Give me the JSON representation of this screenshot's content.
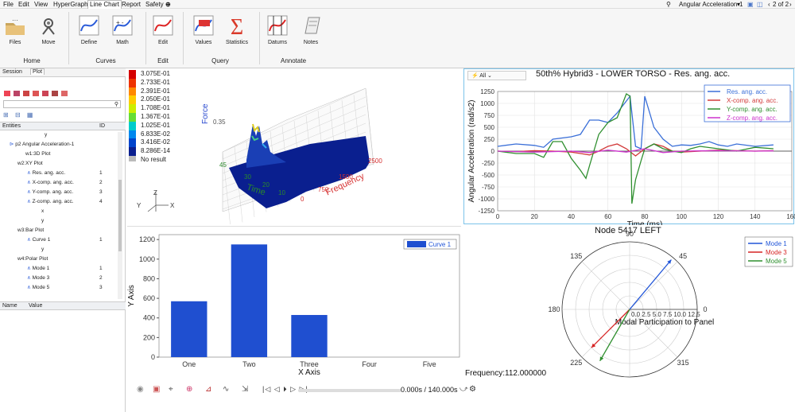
{
  "menubar": {
    "items": [
      "File",
      "Edit",
      "View",
      "HyperGraph",
      "Line Chart",
      "Report",
      "Safety"
    ],
    "page_selector": "Angular Acceleration-1",
    "page_count": "2 of 2"
  },
  "ribbon": {
    "buttons": [
      "Files",
      "Move",
      "Define",
      "Math",
      "Edit",
      "Values",
      "Statistics",
      "Datums",
      "Notes"
    ],
    "groups": [
      "Home",
      "Curves",
      "Edit",
      "Query",
      "Annotate"
    ]
  },
  "left_panel": {
    "tabs": [
      "Session",
      "Plot"
    ],
    "entities_label": "Entities",
    "tree": [
      {
        "label": "y",
        "num": ""
      },
      {
        "label": "p2 Angular Acceleration-1",
        "num": ""
      },
      {
        "label": "w1:3D Plot",
        "num": ""
      },
      {
        "label": "w2:XY Plot",
        "num": ""
      },
      {
        "label": "Res. ang. acc.",
        "num": "1"
      },
      {
        "label": "X-comp. ang. acc.",
        "num": "2"
      },
      {
        "label": "Y-comp. ang. acc.",
        "num": "3"
      },
      {
        "label": "Z-comp. ang. acc.",
        "num": "4"
      },
      {
        "label": "x",
        "num": ""
      },
      {
        "label": "y",
        "num": ""
      },
      {
        "label": "w3:Bar Plot",
        "num": ""
      },
      {
        "label": "Curve 1",
        "num": "1"
      },
      {
        "label": "y",
        "num": ""
      },
      {
        "label": "w4:Polar Plot",
        "num": ""
      },
      {
        "label": "Mode 1",
        "num": "1"
      },
      {
        "label": "Mode 3",
        "num": "2"
      },
      {
        "label": "Mode 5",
        "num": "3"
      }
    ],
    "props_name": "Name",
    "props_value": "Value"
  },
  "plot3d": {
    "legend_values": [
      "3.075E-01",
      "2.733E-01",
      "2.391E-01",
      "2.050E-01",
      "1.708E-01",
      "1.367E-01",
      "1.025E-01",
      "6.833E-02",
      "3.416E-02",
      "8.286E-14"
    ],
    "legend_colors": [
      "#d40000",
      "#ee3300",
      "#ff8800",
      "#ffcc00",
      "#ccee00",
      "#66dd33",
      "#00cccc",
      "#0088ee",
      "#0044cc",
      "#0a1f8f"
    ],
    "no_result": "No result",
    "force_label": "Force",
    "force_tick": "0.35",
    "time_label": "Time",
    "time_ticks": [
      "45",
      "30",
      "20",
      "10"
    ],
    "freq_label": "Frequency",
    "freq_ticks": [
      "2500",
      "1500",
      "750",
      "0"
    ],
    "triad": [
      "Y",
      "Z",
      "X"
    ]
  },
  "chart_data": [
    {
      "type": "line",
      "title": "50th% Hybrid3   - LOWER TORSO - Res. ang. acc.",
      "xlabel": "Time (ms)",
      "ylabel": "Angular Acceleration (rad/s2)",
      "xlim": [
        0,
        160
      ],
      "ylim": [
        -1250,
        1250
      ],
      "xticks": [
        "0",
        "20",
        "40",
        "60",
        "80",
        "100",
        "120",
        "140",
        "160"
      ],
      "yticks": [
        "1250",
        "1000",
        "750",
        "500",
        "250",
        "0",
        "-250",
        "-500",
        "-750",
        "-1000",
        "-1250"
      ],
      "filter_label": "All",
      "series": [
        {
          "name": "Res. ang. acc.",
          "color": "#3a6fd8",
          "x": [
            0,
            10,
            20,
            25,
            30,
            40,
            45,
            50,
            55,
            60,
            65,
            70,
            72,
            75,
            78,
            80,
            85,
            90,
            95,
            100,
            105,
            110,
            115,
            120,
            125,
            130,
            140,
            150
          ],
          "y": [
            100,
            150,
            120,
            80,
            250,
            300,
            350,
            650,
            650,
            600,
            800,
            1050,
            1150,
            100,
            50,
            1150,
            500,
            250,
            100,
            130,
            120,
            150,
            200,
            130,
            100,
            150,
            100,
            130
          ]
        },
        {
          "name": "X-comp. ang. acc.",
          "color": "#d23a3a",
          "x": [
            0,
            10,
            20,
            30,
            40,
            45,
            50,
            55,
            60,
            65,
            70,
            75,
            80,
            85,
            90,
            95,
            100,
            110,
            120,
            130,
            140,
            150
          ],
          "y": [
            0,
            -10,
            10,
            0,
            -20,
            -50,
            -80,
            0,
            100,
            150,
            50,
            -100,
            50,
            150,
            100,
            0,
            -20,
            0,
            20,
            10,
            0,
            10
          ]
        },
        {
          "name": "Y-comp. ang. acc.",
          "color": "#2f8f2f",
          "x": [
            0,
            10,
            20,
            25,
            30,
            35,
            40,
            45,
            48,
            50,
            55,
            60,
            65,
            70,
            72,
            73,
            75,
            78,
            80,
            85,
            90,
            95,
            100,
            105,
            110,
            120,
            130,
            140,
            150
          ],
          "y": [
            0,
            -50,
            -50,
            -130,
            200,
            200,
            -150,
            -400,
            -570,
            -300,
            350,
            600,
            700,
            1200,
            1150,
            -1100,
            -600,
            -200,
            50,
            150,
            50,
            0,
            -30,
            50,
            100,
            50,
            0,
            80,
            50
          ]
        },
        {
          "name": "Z-comp. ang. acc.",
          "color": "#cc33cc",
          "x": [
            0,
            20,
            40,
            50,
            60,
            70,
            80,
            90,
            100,
            120,
            140,
            150
          ],
          "y": [
            0,
            -20,
            0,
            -30,
            20,
            -20,
            50,
            -30,
            0,
            10,
            0,
            5
          ]
        }
      ]
    },
    {
      "type": "bar",
      "categories": [
        "One",
        "Two",
        "Three",
        "Four",
        "Five"
      ],
      "values": [
        570,
        1150,
        430,
        0,
        0
      ],
      "xlabel": "X Axis",
      "ylabel": "Y Axis",
      "ylim": [
        0,
        1250
      ],
      "yticks": [
        "0",
        "200",
        "400",
        "600",
        "800",
        "1000",
        "1200"
      ],
      "series": [
        {
          "name": "Curve 1",
          "color": "#1f4fd0"
        }
      ]
    },
    {
      "type": "polar",
      "title": "Node 5417 LEFT",
      "angle_labels": [
        "90",
        "45",
        "0",
        "315",
        "270",
        "225",
        "180",
        "135"
      ],
      "radial_labels": "0.0 2.5 5.0 7.5 10.0 12.5",
      "radial_axis_label": "Modal Participation to Panel",
      "series": [
        {
          "name": "Mode 1",
          "color": "#2155d8",
          "angle_deg": 50,
          "r": 12
        },
        {
          "name": "Mode 3",
          "color": "#d62424",
          "angle_deg": 225,
          "r": 10
        },
        {
          "name": "Mode 5",
          "color": "#2f8f2f",
          "angle_deg": 240,
          "r": 11
        }
      ],
      "readout": "Frequency:112.000000"
    }
  ],
  "playback": {
    "time_readout": "0.000s / 140.000s"
  }
}
